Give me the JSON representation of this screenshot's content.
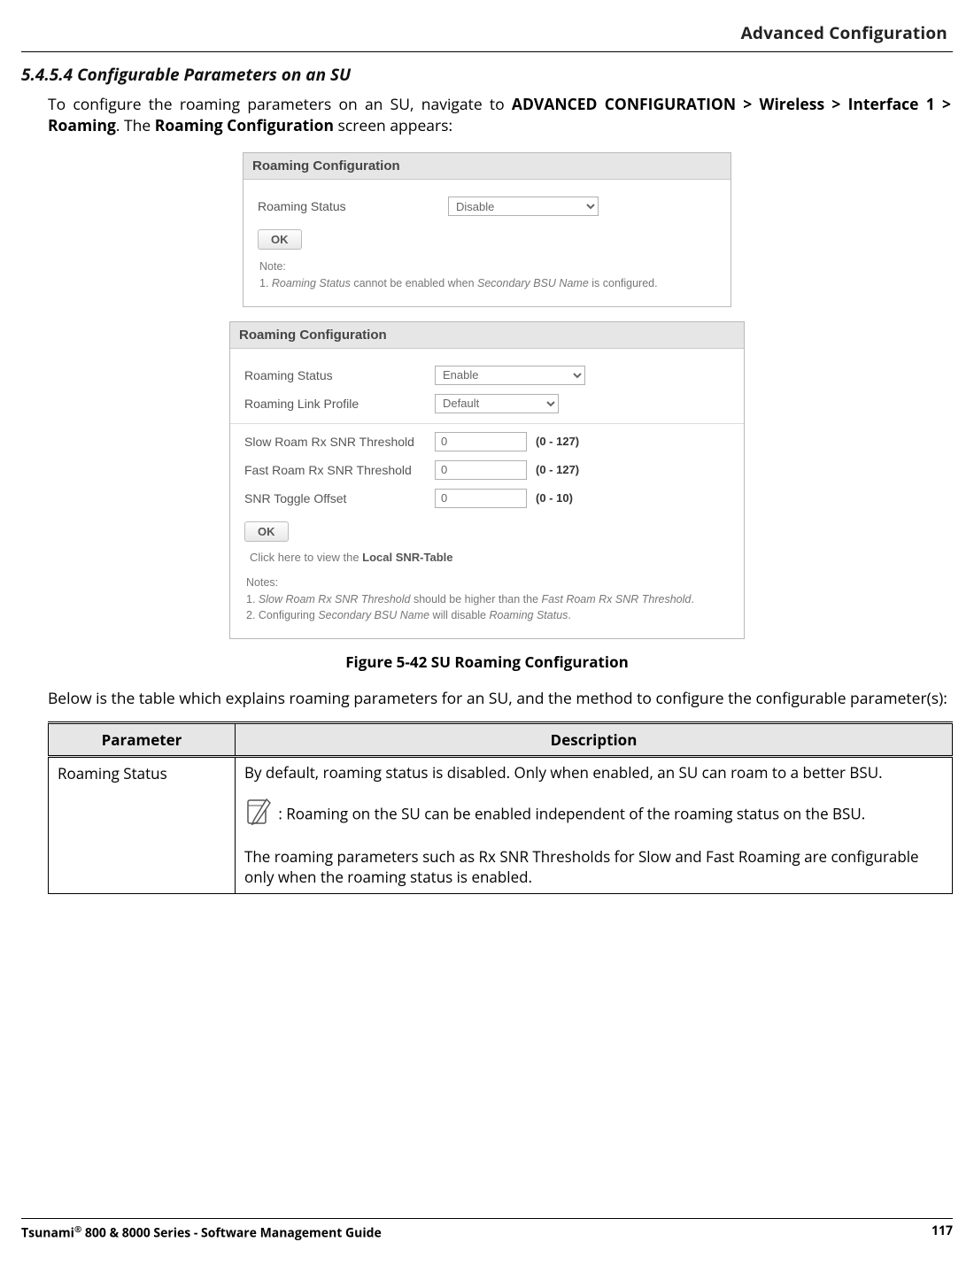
{
  "header": {
    "chapter": "Advanced Configuration"
  },
  "section": {
    "number": "5.4.5.4",
    "title": "Configurable Parameters on an SU"
  },
  "intro": {
    "pre": "To configure the roaming parameters on an SU, navigate to ",
    "bold": "ADVANCED CONFIGURATION > Wireless > Interface 1 > Roaming",
    "post1": ". The ",
    "bold2": "Roaming Configuration",
    "post2": " screen appears:"
  },
  "panel1": {
    "title": "Roaming Configuration",
    "status_label": "Roaming Status",
    "status_value": "Disable",
    "ok": "OK",
    "note_label": "Note:",
    "note_pre": "1. ",
    "note_em1": "Roaming Status",
    "note_mid": " cannot be enabled when ",
    "note_em2": "Secondary BSU Name",
    "note_post": " is configured."
  },
  "panel2": {
    "title": "Roaming Configuration",
    "r1_label": "Roaming Status",
    "r1_value": "Enable",
    "r2_label": "Roaming Link Profile",
    "r2_value": "Default",
    "r3_label": "Slow Roam Rx SNR Threshold",
    "r3_value": "0",
    "r3_hint": "(0 - 127)",
    "r4_label": "Fast Roam Rx SNR Threshold",
    "r4_value": "0",
    "r4_hint": "(0 - 127)",
    "r5_label": "SNR Toggle Offset",
    "r5_value": "0",
    "r5_hint": "(0 - 10)",
    "ok": "OK",
    "snr_link_pre": "Click here to view the ",
    "snr_link_bold": "Local SNR-Table",
    "notes_label": "Notes:",
    "n1_pre": "1. ",
    "n1_em1": "Slow Roam Rx SNR Threshold",
    "n1_mid": " should be higher than the ",
    "n1_em2": "Fast Roam Rx SNR Threshold",
    "n1_post": ".",
    "n2_pre": "2. Configuring ",
    "n2_em1": "Secondary BSU Name",
    "n2_mid": " will disable ",
    "n2_em2": "Roaming Status",
    "n2_post": "."
  },
  "figure_caption": "Figure 5-42 SU Roaming Configuration",
  "below_text": "Below is the table which explains roaming parameters for an SU, and the method to configure the configurable parameter(s):",
  "table": {
    "col_param": "Parameter",
    "col_desc": "Description",
    "row1_param": "Roaming Status",
    "row1_desc_p1": "By default, roaming status is disabled. Only when enabled, an SU can roam to a better BSU.",
    "row1_desc_p2": ": Roaming on the SU can be enabled independent of the roaming status on the BSU.",
    "row1_desc_p3": "The roaming parameters such as Rx SNR Thresholds for Slow and Fast Roaming are configurable only when the roaming status is enabled."
  },
  "footer": {
    "left_pre": "Tsunami",
    "left_sup": "®",
    "left_post": " 800 & 8000 Series - Software Management Guide",
    "page": "117"
  }
}
